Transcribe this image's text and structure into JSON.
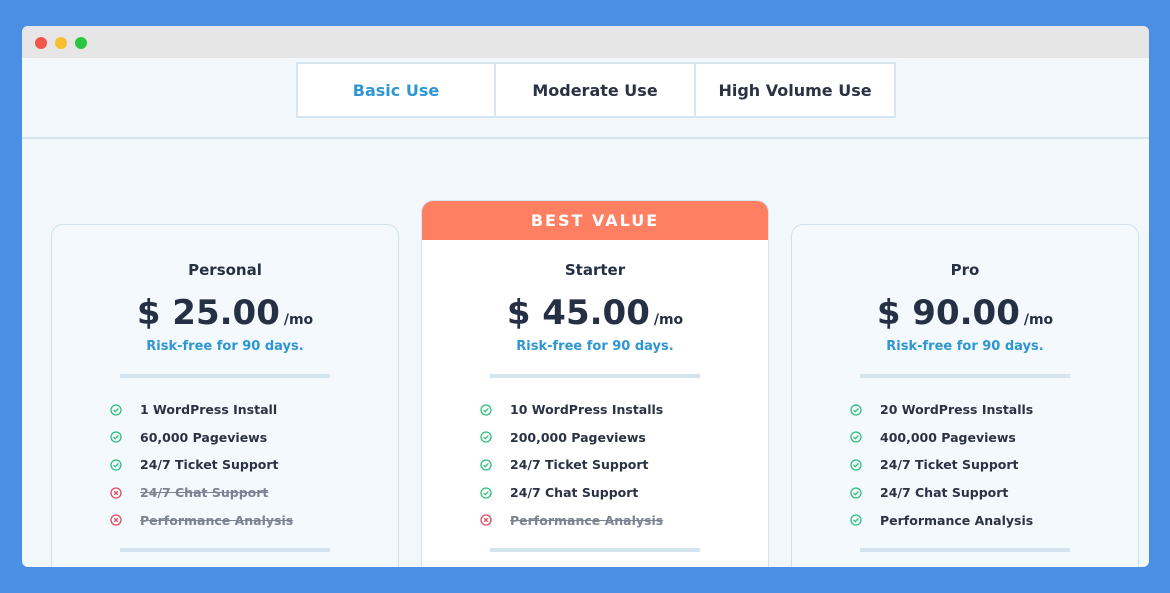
{
  "window": {
    "controls": [
      "close",
      "minimize",
      "maximize"
    ]
  },
  "tabs": [
    {
      "label": "Basic Use",
      "active": true
    },
    {
      "label": "Moderate Use",
      "active": false
    },
    {
      "label": "High Volume Use",
      "active": false
    }
  ],
  "colors": {
    "accent": "#2f96d4",
    "badge": "#ff7f63",
    "check": "#2cbf7d",
    "cross": "#e24a5e",
    "background": "#4a8fe4"
  },
  "plans": [
    {
      "name": "Personal",
      "price": "$ 25.00",
      "period": "/mo",
      "note": "Risk-free for 90 days.",
      "features": [
        {
          "text": "1 WordPress Install",
          "included": true
        },
        {
          "text": "60,000 Pageviews",
          "included": true
        },
        {
          "text": "24/7 Ticket Support",
          "included": true
        },
        {
          "text": "24/7 Chat Support",
          "included": false
        },
        {
          "text": "Performance Analysis",
          "included": false
        }
      ]
    },
    {
      "badge": "BEST VALUE",
      "name": "Starter",
      "price": "$ 45.00",
      "period": "/mo",
      "note": "Risk-free for 90 days.",
      "features": [
        {
          "text": "10 WordPress Installs",
          "included": true
        },
        {
          "text": "200,000 Pageviews",
          "included": true
        },
        {
          "text": "24/7 Ticket Support",
          "included": true
        },
        {
          "text": "24/7 Chat Support",
          "included": true
        },
        {
          "text": "Performance Analysis",
          "included": false
        }
      ]
    },
    {
      "name": "Pro",
      "price": "$ 90.00",
      "period": "/mo",
      "note": "Risk-free for 90 days.",
      "features": [
        {
          "text": "20 WordPress Installs",
          "included": true
        },
        {
          "text": "400,000 Pageviews",
          "included": true
        },
        {
          "text": "24/7 Ticket Support",
          "included": true
        },
        {
          "text": "24/7 Chat Support",
          "included": true
        },
        {
          "text": "Performance Analysis",
          "included": true
        }
      ]
    }
  ]
}
